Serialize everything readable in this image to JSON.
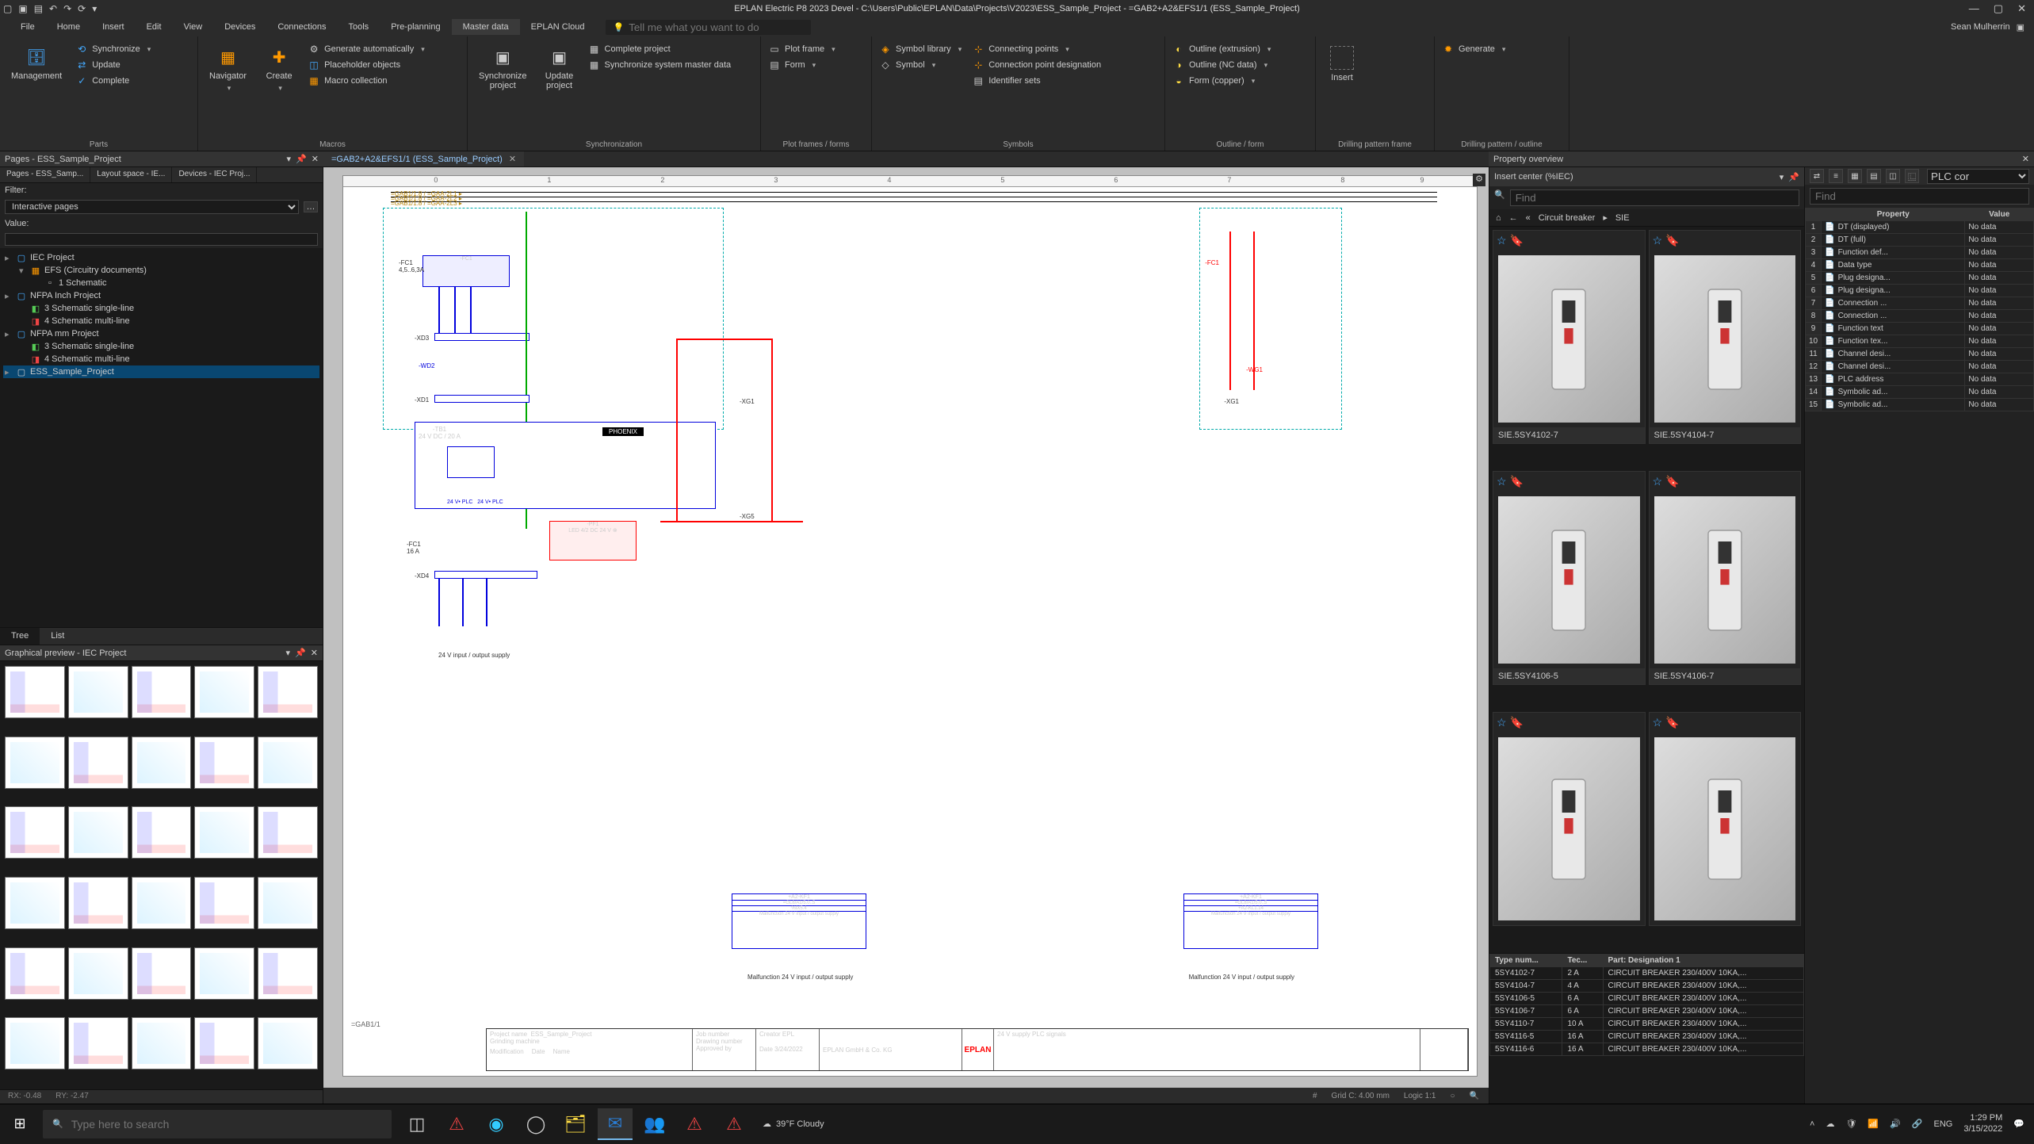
{
  "app": {
    "title": "EPLAN Electric P8 2023 Devel - C:\\Users\\Public\\EPLAN\\Data\\Projects\\V2023\\ESS_Sample_Project - =GAB2+A2&EFS1/1 (ESS_Sample_Project)",
    "user": "Sean Mulherrin"
  },
  "menu": {
    "file": "File",
    "home": "Home",
    "insert": "Insert",
    "edit": "Edit",
    "view": "View",
    "devices": "Devices",
    "connections": "Connections",
    "tools": "Tools",
    "preplanning": "Pre-planning",
    "masterdata": "Master data",
    "cloud": "EPLAN Cloud",
    "tellme": "Tell me what you want to do"
  },
  "ribbon": {
    "parts": {
      "label": "Parts",
      "management": "Management",
      "synchronize": "Synchronize",
      "update": "Update",
      "complete": "Complete"
    },
    "macros": {
      "label": "Macros",
      "navigator": "Navigator",
      "create": "Create",
      "genauto": "Generate automatically",
      "placeholder": "Placeholder objects",
      "collection": "Macro collection"
    },
    "sync": {
      "label": "Synchronization",
      "syncproj": "Synchronize\nproject",
      "updproj": "Update\nproject",
      "compproj": "Complete project",
      "syncsys": "Synchronize system master data"
    },
    "plotframes": {
      "label": "Plot frames / forms",
      "plotframe": "Plot frame",
      "form": "Form"
    },
    "symbols": {
      "label": "Symbols",
      "symlib": "Symbol library",
      "symbol": "Symbol",
      "connpts": "Connecting points",
      "connptdesig": "Connection point designation",
      "identsets": "Identifier sets"
    },
    "outlineform": {
      "label": "Outline / form",
      "extrusion": "Outline (extrusion)",
      "ncdata": "Outline (NC data)",
      "formcopper": "Form (copper)"
    },
    "drillframe": {
      "label": "Drilling pattern frame",
      "insert": "Insert"
    },
    "drilloutline": {
      "label": "Drilling pattern / outline",
      "generate": "Generate"
    }
  },
  "doctab": {
    "name": "=GAB2+A2&EFS1/1 (ESS_Sample_Project)"
  },
  "pages": {
    "title": "Pages - ESS_Sample_Project",
    "subtabs": {
      "a": "Pages - ESS_Samp...",
      "b": "Layout space - IE...",
      "c": "Devices - IEC Proj..."
    },
    "filter_label": "Filter:",
    "filter_value": "Interactive pages",
    "value_label": "Value:",
    "tree": {
      "iec": "IEC Project",
      "efs": "EFS (Circuitry documents)",
      "schem1": "1 Schematic",
      "nfpa_in": "NFPA Inch Project",
      "sl3_in": "3 Schematic single-line",
      "ml4_in": "4 Schematic multi-line",
      "nfpa_mm": "NFPA mm Project",
      "sl3_mm": "3 Schematic single-line",
      "ml4_mm": "4 Schematic multi-line",
      "ess": "ESS_Sample_Project"
    },
    "tab_tree": "Tree",
    "tab_list": "List"
  },
  "preview": {
    "title": "Graphical preview - IEC Project"
  },
  "status_mini": {
    "rx": "RX: -0.48",
    "ry": "RY: -2.47"
  },
  "canvas": {
    "pageref": "=GAB1/1",
    "caption1": "24 V input / output supply",
    "caption2": "Malfunction 24 V input / output supply",
    "caption3": "Malfunction 24 V input / output supply",
    "titleblock": {
      "projname_l": "Project name",
      "projname_v": "ESS_Sample_Project",
      "desc_l": "",
      "desc_v": "Grinding  machine",
      "mod_l": "Modification",
      "date_l": "Date",
      "name_l": "Name",
      "creator_l": "Creator",
      "creator_v": "EPL",
      "company": "EPLAN GmbH & Co. KG",
      "pagetitle": "24 V supply PLC signals",
      "jobno_l": "Job number",
      "drawno_l": "Drawing number",
      "approved_l": "Approved by",
      "date_v": "3/24/2022"
    },
    "status": {
      "grid": "Grid C: 4.00 mm",
      "logic": "Logic 1:1"
    }
  },
  "insert": {
    "title": "Insert center (%IEC)",
    "find": "Find",
    "crumb1": "Circuit breaker",
    "crumb2": "SIE",
    "items": [
      "SIE.5SY4102-7",
      "SIE.5SY4104-7",
      "SIE.5SY4106-5",
      "SIE.5SY4106-7",
      "",
      ""
    ],
    "parts_header": {
      "type": "Type num...",
      "tech": "Tec...",
      "desig": "Part: Designation 1"
    },
    "parts": [
      {
        "n": "5SY4102-7",
        "t": "2 A",
        "d": "CIRCUIT BREAKER 230/400V 10KA,..."
      },
      {
        "n": "5SY4104-7",
        "t": "4 A",
        "d": "CIRCUIT BREAKER 230/400V 10KA,..."
      },
      {
        "n": "5SY4106-5",
        "t": "6 A",
        "d": "CIRCUIT BREAKER 230/400V 10KA,..."
      },
      {
        "n": "5SY4106-7",
        "t": "6 A",
        "d": "CIRCUIT BREAKER 230/400V 10KA,..."
      },
      {
        "n": "5SY4110-7",
        "t": "10 A",
        "d": "CIRCUIT BREAKER 230/400V 10KA,..."
      },
      {
        "n": "5SY4116-5",
        "t": "16 A",
        "d": "CIRCUIT BREAKER 230/400V 10KA,..."
      },
      {
        "n": "5SY4116-6",
        "t": "16 A",
        "d": "CIRCUIT BREAKER 230/400V 10KA,..."
      }
    ]
  },
  "props": {
    "title": "Property overview",
    "find": "Find",
    "plc": "PLC cor",
    "header": {
      "p": "Property",
      "v": "Value"
    },
    "rows": [
      {
        "i": "1",
        "p": "DT (displayed)",
        "v": "No data"
      },
      {
        "i": "2",
        "p": "DT (full)",
        "v": "No data"
      },
      {
        "i": "3",
        "p": "Function def...",
        "v": "No data"
      },
      {
        "i": "4",
        "p": "Data type",
        "v": "No data"
      },
      {
        "i": "5",
        "p": "Plug designa...",
        "v": "No data"
      },
      {
        "i": "6",
        "p": "Plug designa...",
        "v": "No data"
      },
      {
        "i": "7",
        "p": "Connection ...",
        "v": "No data"
      },
      {
        "i": "8",
        "p": "Connection ...",
        "v": "No data"
      },
      {
        "i": "9",
        "p": "Function text",
        "v": "No data"
      },
      {
        "i": "10",
        "p": "Function tex...",
        "v": "No data"
      },
      {
        "i": "11",
        "p": "Channel desi...",
        "v": "No data"
      },
      {
        "i": "12",
        "p": "Channel desi...",
        "v": "No data"
      },
      {
        "i": "13",
        "p": "PLC address",
        "v": "No data"
      },
      {
        "i": "14",
        "p": "Symbolic ad...",
        "v": "No data"
      },
      {
        "i": "15",
        "p": "Symbolic ad...",
        "v": "No data"
      }
    ]
  },
  "taskbar": {
    "search": "Type here to search",
    "weather": "39°F Cloudy",
    "lang": "ENG",
    "time": "1:29 PM",
    "date": "3/15/2022"
  }
}
